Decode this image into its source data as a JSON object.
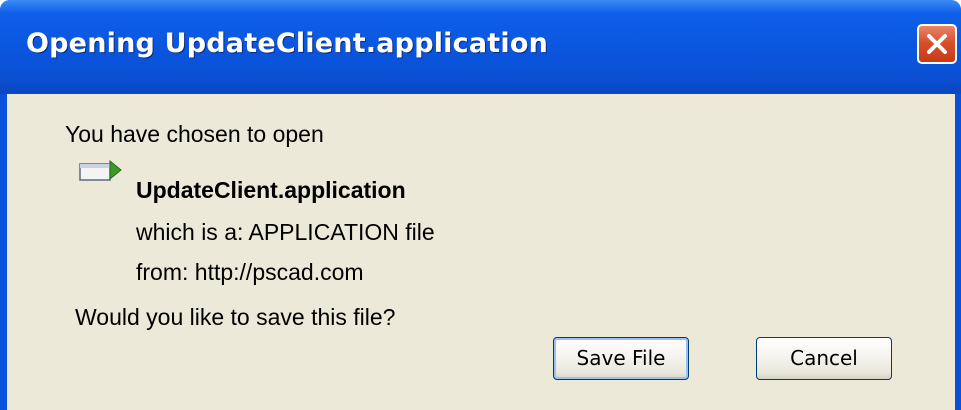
{
  "window": {
    "title": "Opening UpdateClient.application"
  },
  "dialog": {
    "intro": "You have chosen to open",
    "file_icon": "application-file-icon",
    "filename": "UpdateClient.application",
    "filetype": "which is a: APPLICATION file",
    "source": "from: http://pscad.com",
    "question": "Would you like to save this file?"
  },
  "buttons": {
    "save_label": "Save File",
    "cancel_label": "Cancel"
  },
  "colors": {
    "titlebar": "#0a55de",
    "client_background": "#ece9d8",
    "close_button": "#d9502c",
    "button_border": "#003c74"
  }
}
